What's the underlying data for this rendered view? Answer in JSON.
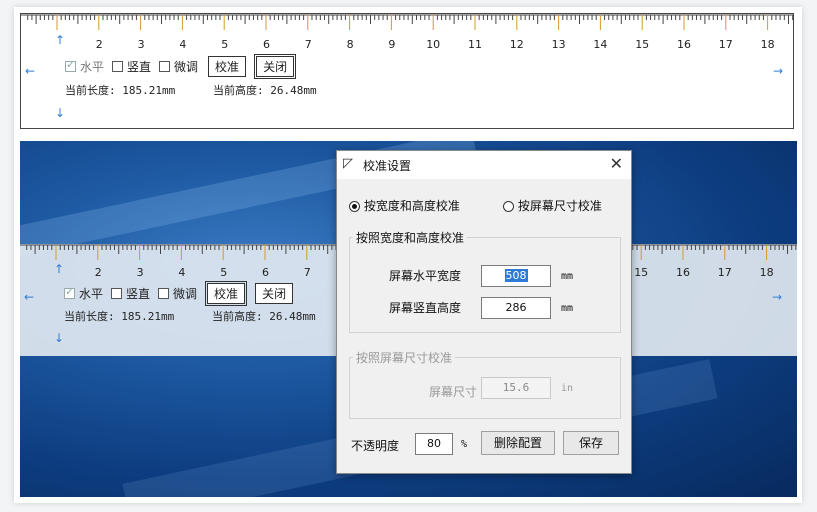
{
  "ruler": {
    "numbers": [
      "2",
      "3",
      "4",
      "5",
      "6",
      "7",
      "8",
      "9",
      "10",
      "11",
      "12",
      "13",
      "14",
      "15",
      "16",
      "17",
      "18"
    ],
    "numbers_overlay_left": [
      "2",
      "3",
      "4",
      "5",
      "6",
      "7"
    ],
    "numbers_overlay_right": [
      "15",
      "16",
      "17",
      "18"
    ],
    "controls": {
      "horizontal_label": "水平",
      "horizontal_checked": true,
      "vertical_label": "竖直",
      "vertical_checked": false,
      "finetune_label": "微调",
      "finetune_checked": false,
      "calibrate_button": "校准",
      "close_button": "关闭"
    },
    "readout": {
      "length_label": "当前长度:",
      "length_value": "185.21mm",
      "height_label": "当前高度:",
      "height_value": "26.48mm"
    }
  },
  "dialog": {
    "title": "校准设置",
    "radio_width_height": "按宽度和高度校准",
    "radio_screen_size": "按屏幕尺寸校准",
    "selected_mode": "width_height",
    "group_wh_title": "按照宽度和高度校准",
    "screen_width_label": "屏幕水平宽度",
    "screen_width_value": "508",
    "screen_width_unit": "mm",
    "screen_height_label": "屏幕竖直高度",
    "screen_height_value": "286",
    "screen_height_unit": "mm",
    "group_size_title": "按照屏幕尺寸校准",
    "screen_size_label": "屏幕尺寸",
    "screen_size_value": "15.6",
    "screen_size_unit": "in",
    "opacity_label": "不透明度",
    "opacity_value": "80",
    "opacity_unit": "%",
    "delete_button": "删除配置",
    "save_button": "保存"
  }
}
